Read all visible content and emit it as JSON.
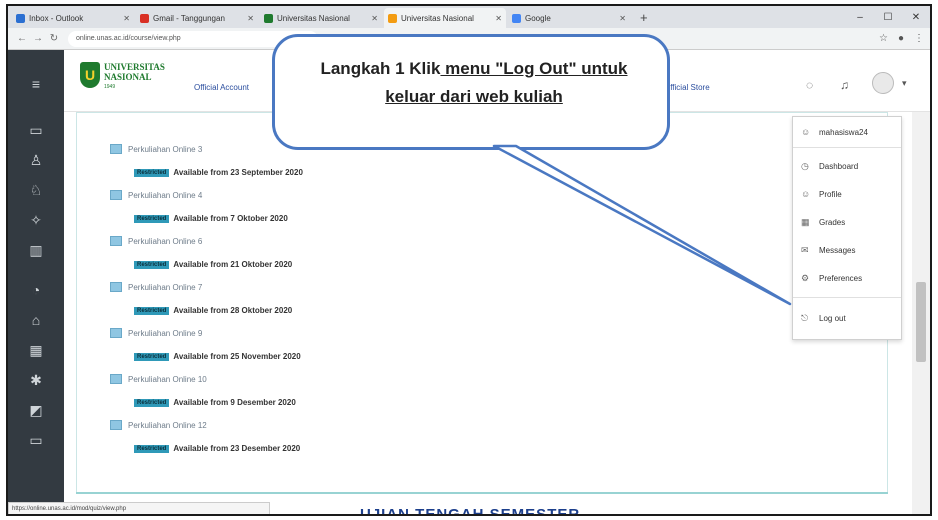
{
  "browser": {
    "tabs": [
      {
        "title": "Inbox - Outlook",
        "color": "#2b6fd1",
        "active": false
      },
      {
        "title": "Gmail - Tanggungan",
        "color": "#d93025",
        "active": false
      },
      {
        "title": "Universitas Nasional",
        "color": "#1f7a2e",
        "active": false
      },
      {
        "title": "Universitas Nasional",
        "color": "#f39c12",
        "active": true
      },
      {
        "title": "Google",
        "color": "#4285f4",
        "active": false
      }
    ],
    "new_tab": "+",
    "window_controls": [
      "–",
      "☐",
      "✕"
    ],
    "url": "online.unas.ac.id/course/view.php",
    "status_url": "https://online.unas.ac.id/mod/quiz/view.php"
  },
  "header": {
    "logo_text_1": "UNIVERSITAS",
    "logo_text_2": "NASIONAL",
    "logo_sub": "1949",
    "link_left": "Official Account",
    "link_right": "Official Store"
  },
  "activities": [
    {
      "title": "Perkuliahan Online 3",
      "available": "Available from 23 September 2020"
    },
    {
      "title": "Perkuliahan Online 4",
      "available": "Available from 7 Oktober 2020"
    },
    {
      "title": "Perkuliahan Online 6",
      "available": "Available from 21 Oktober 2020"
    },
    {
      "title": "Perkuliahan Online 7",
      "available": "Available from 28 Oktober 2020"
    },
    {
      "title": "Perkuliahan Online 9",
      "available": "Available from 25 November 2020"
    },
    {
      "title": "Perkuliahan Online 10",
      "available": "Available from 9 Desember 2020"
    },
    {
      "title": "Perkuliahan Online 12",
      "available": "Available from 23 Desember 2020"
    }
  ],
  "badge_label": "Restricted",
  "exam_title": "UJIAN TENGAH SEMESTER",
  "dropdown": {
    "username": "mahasiswa24",
    "items": [
      {
        "label": "Dashboard",
        "icon": "dashboard-icon",
        "glyph": "◷"
      },
      {
        "label": "Profile",
        "icon": "profile-icon",
        "glyph": "☺"
      },
      {
        "label": "Grades",
        "icon": "grades-icon",
        "glyph": "▦"
      },
      {
        "label": "Messages",
        "icon": "messages-icon",
        "glyph": "✉"
      },
      {
        "label": "Preferences",
        "icon": "preferences-icon",
        "glyph": "⚙"
      }
    ],
    "logout": "Log out"
  },
  "callout": {
    "line1_a": "Langkah 1 Klik",
    "line1_b": " menu \"Log Out\" ",
    "line1_c": "untuk",
    "line2": "keluar dari web kuliah"
  }
}
